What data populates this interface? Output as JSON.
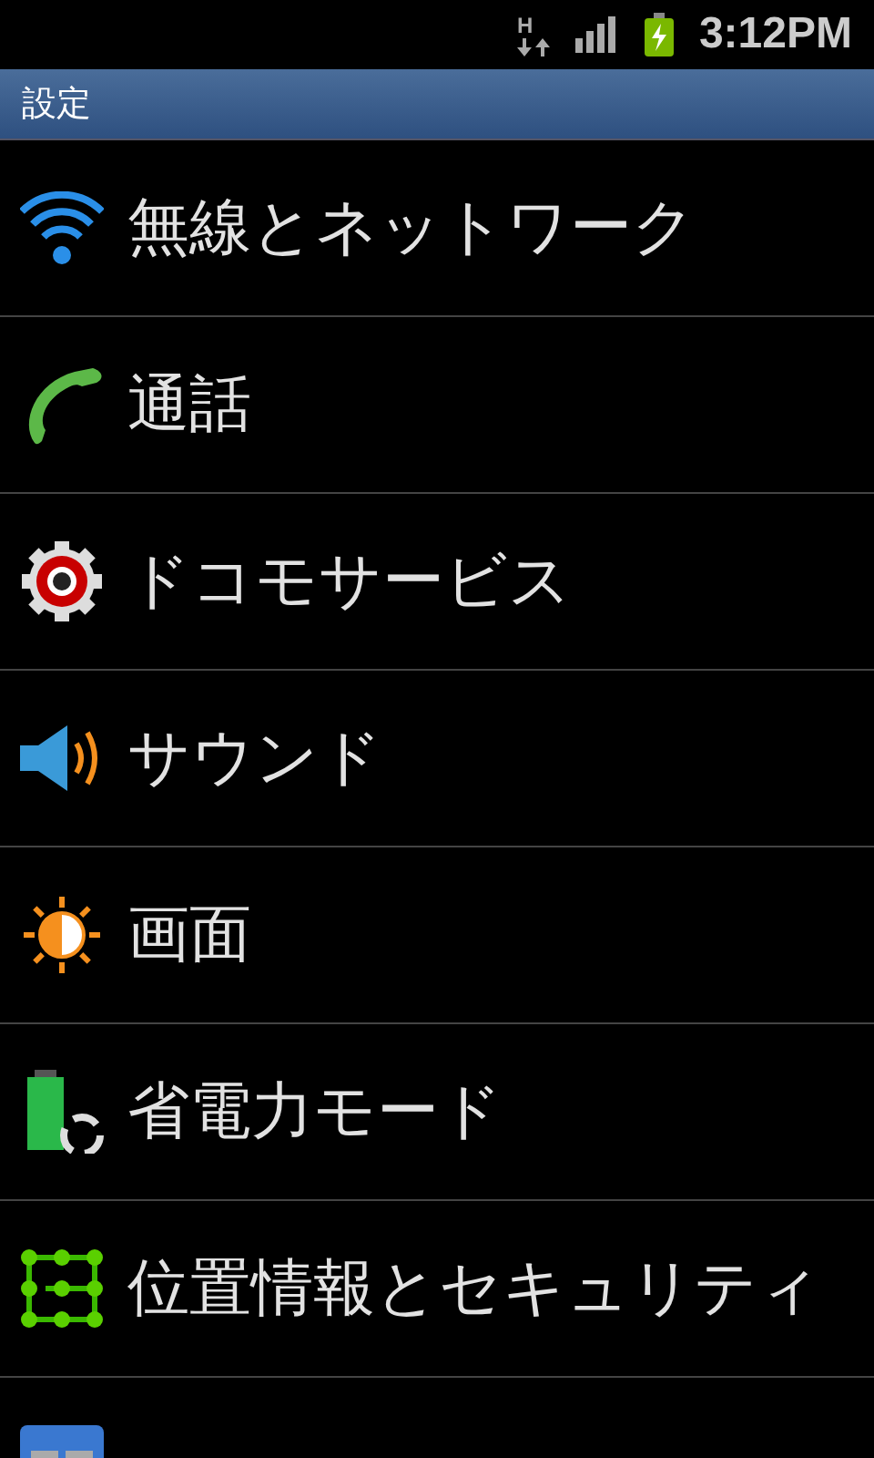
{
  "status_bar": {
    "network": "H",
    "time": "3:12PM"
  },
  "title_bar": {
    "title": "設定"
  },
  "items": [
    {
      "label": "無線とネットワーク"
    },
    {
      "label": "通話"
    },
    {
      "label": "ドコモサービス"
    },
    {
      "label": "サウンド"
    },
    {
      "label": "画面"
    },
    {
      "label": "省電力モード"
    },
    {
      "label": "位置情報とセキュリティ"
    }
  ]
}
